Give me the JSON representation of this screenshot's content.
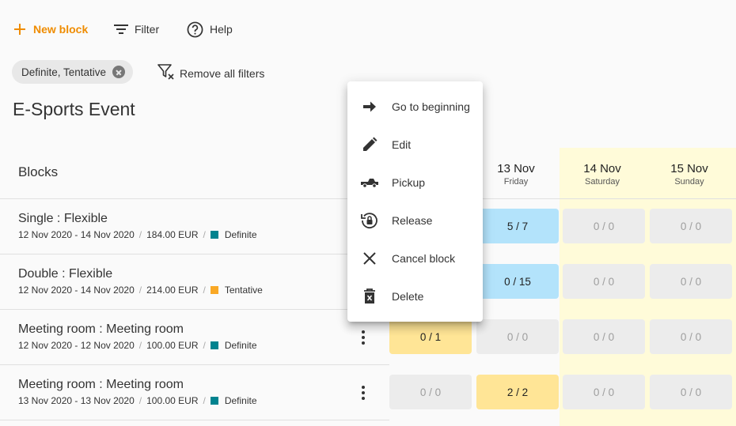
{
  "toolbar": {
    "new_block": "New block",
    "filter": "Filter",
    "help": "Help"
  },
  "filters": {
    "chip_label": "Definite, Tentative",
    "remove_all": "Remove all filters"
  },
  "page_title": "E-Sports Event",
  "grid": {
    "blocks_header": "Blocks",
    "days": [
      {
        "date": "13 Nov",
        "weekday": "Friday"
      },
      {
        "date": "14 Nov",
        "weekday": "Saturday"
      },
      {
        "date": "15 Nov",
        "weekday": "Sunday"
      }
    ],
    "rows": [
      {
        "name": "Single : Flexible",
        "dates": "12 Nov 2020 - 14 Nov 2020",
        "price": "184.00 EUR",
        "status": "Definite",
        "status_color": "#00838f",
        "cells": [
          "5 / 7",
          "0 / 0",
          "0 / 0"
        ]
      },
      {
        "name": "Double : Flexible",
        "dates": "12 Nov 2020 - 14 Nov 2020",
        "price": "214.00 EUR",
        "status": "Tentative",
        "status_color": "#f9a825",
        "cells": [
          "0 / 15",
          "0 / 0",
          "0 / 0"
        ]
      },
      {
        "name": "Meeting room : Meeting room",
        "dates": "12 Nov 2020 - 12 Nov 2020",
        "price": "100.00 EUR",
        "status": "Definite",
        "status_color": "#00838f",
        "cells": [
          "0 / 1",
          "0 / 0",
          "0 / 0",
          "0 / 0"
        ]
      },
      {
        "name": "Meeting room : Meeting room",
        "dates": "13 Nov 2020 - 13 Nov 2020",
        "price": "100.00 EUR",
        "status": "Definite",
        "status_color": "#00838f",
        "cells": [
          "0 / 0",
          "2 / 2",
          "0 / 0",
          "0 / 0"
        ]
      }
    ]
  },
  "context_menu": {
    "items": [
      {
        "label": "Go to beginning",
        "icon": "arrow-right-icon"
      },
      {
        "label": "Edit",
        "icon": "pencil-icon"
      },
      {
        "label": "Pickup",
        "icon": "pickup-truck-icon"
      },
      {
        "label": "Release",
        "icon": "release-lock-icon"
      },
      {
        "label": "Cancel block",
        "icon": "close-icon"
      },
      {
        "label": "Delete",
        "icon": "trash-icon"
      }
    ]
  },
  "colors": {
    "accent": "#ef8c00",
    "weekend": "#fffbd9",
    "blue_cell": "#b3e3fb",
    "yellow_cell": "#ffe596",
    "grey_cell": "#ececec"
  }
}
